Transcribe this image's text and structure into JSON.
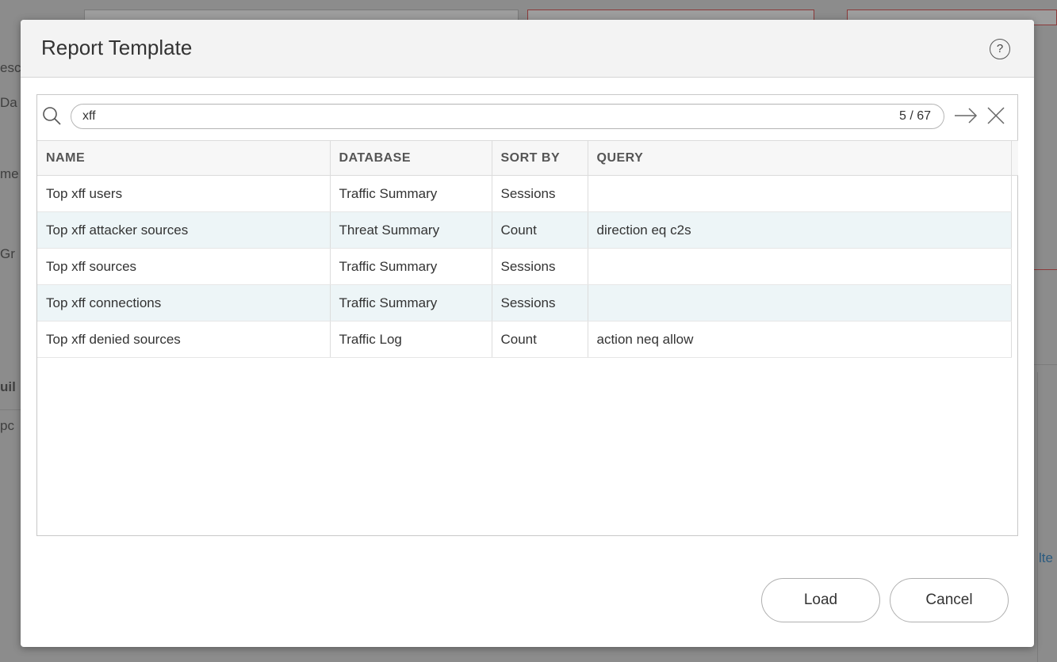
{
  "background": {
    "fragments": [
      "esc",
      "Da",
      "me",
      "Gr",
      "uil",
      "pc",
      "lte"
    ]
  },
  "modal": {
    "title": "Report Template",
    "help_icon": "help-circle-icon",
    "help_glyph": "?"
  },
  "search": {
    "value": "xff",
    "count": "5 / 67",
    "icons": [
      "search-icon",
      "next-arrow-icon",
      "close-icon"
    ]
  },
  "table": {
    "columns": [
      "NAME",
      "DATABASE",
      "SORT BY",
      "QUERY"
    ],
    "rows": [
      {
        "name": "Top xff users",
        "database": "Traffic Summary",
        "sort_by": "Sessions",
        "query": ""
      },
      {
        "name": "Top xff attacker sources",
        "database": "Threat Summary",
        "sort_by": "Count",
        "query": "direction eq c2s"
      },
      {
        "name": "Top xff sources",
        "database": "Traffic Summary",
        "sort_by": "Sessions",
        "query": ""
      },
      {
        "name": "Top xff connections",
        "database": "Traffic Summary",
        "sort_by": "Sessions",
        "query": ""
      },
      {
        "name": "Top xff denied sources",
        "database": "Traffic Log",
        "sort_by": "Count",
        "query": "action neq allow"
      }
    ]
  },
  "buttons": {
    "load": "Load",
    "cancel": "Cancel"
  },
  "colors": {
    "row_alt": "#edf5f7",
    "header_bg": "#f3f3f3",
    "overlay": "#8c8c8c"
  }
}
